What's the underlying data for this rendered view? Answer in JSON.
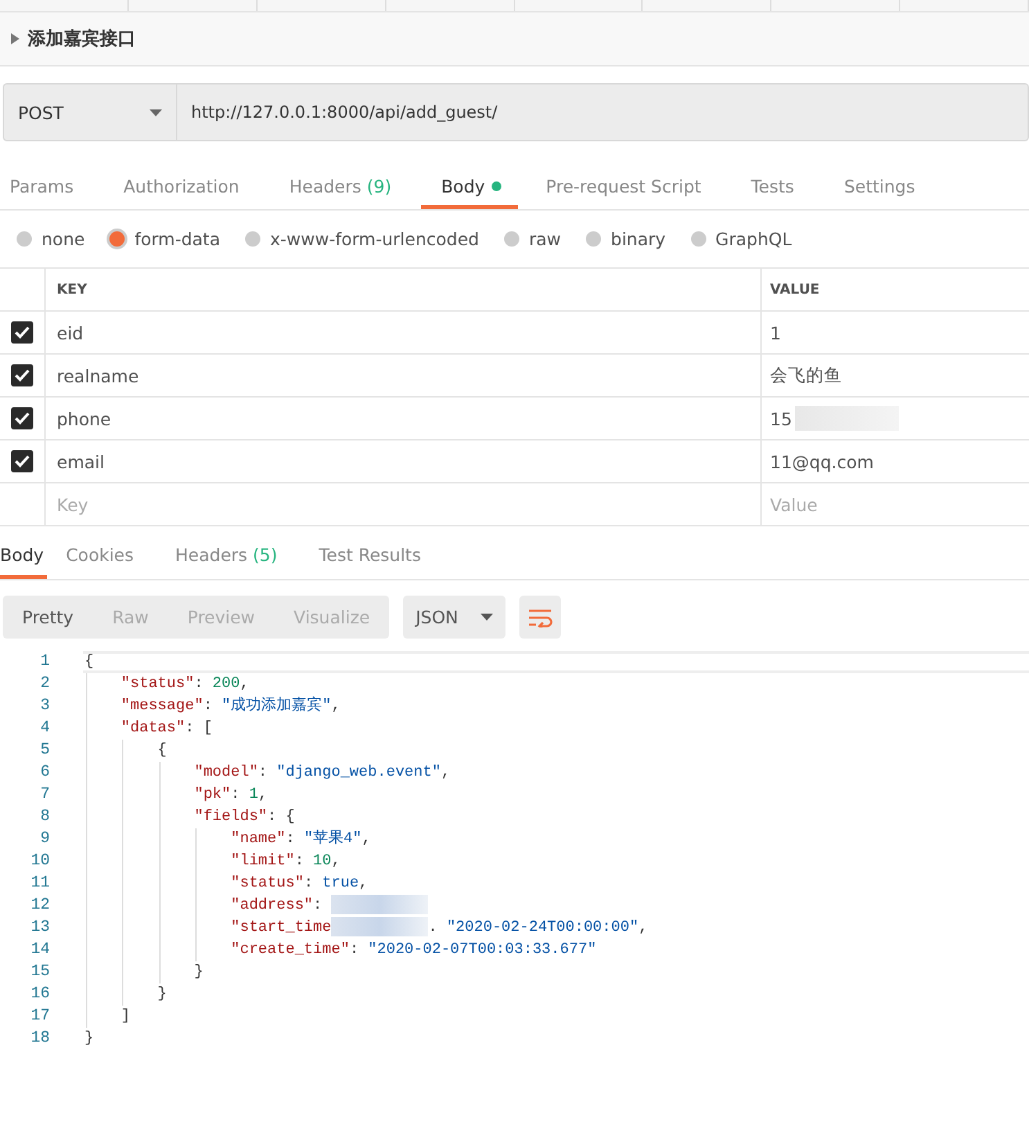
{
  "request": {
    "title": "添加嘉宾接口",
    "method": "POST",
    "url": "http://127.0.0.1:8000/api/add_guest/"
  },
  "request_tabs": [
    {
      "label": "Params",
      "selected": false
    },
    {
      "label": "Authorization",
      "selected": false
    },
    {
      "label": "Headers",
      "count": "(9)",
      "selected": false
    },
    {
      "label": "Body",
      "dot": true,
      "selected": true
    },
    {
      "label": "Pre-request Script",
      "selected": false
    },
    {
      "label": "Tests",
      "selected": false
    },
    {
      "label": "Settings",
      "selected": false
    }
  ],
  "body_types": [
    {
      "label": "none",
      "selected": false
    },
    {
      "label": "form-data",
      "selected": true
    },
    {
      "label": "x-www-form-urlencoded",
      "selected": false
    },
    {
      "label": "raw",
      "selected": false
    },
    {
      "label": "binary",
      "selected": false
    },
    {
      "label": "GraphQL",
      "selected": false
    }
  ],
  "params": {
    "columns": [
      "KEY",
      "VALUE"
    ],
    "rows": [
      {
        "key": "eid",
        "value": "1",
        "checked": true
      },
      {
        "key": "realname",
        "value": "会飞的鱼",
        "checked": true
      },
      {
        "key": "phone",
        "value": "15",
        "checked": true,
        "redacted": true
      },
      {
        "key": "email",
        "value": "11@qq.com",
        "checked": true
      }
    ],
    "new_row": {
      "key": {
        "placeholder": "Key"
      },
      "value": {
        "placeholder": "Value"
      }
    }
  },
  "response_tabs": [
    {
      "label": "Body",
      "selected": true
    },
    {
      "label": "Cookies",
      "selected": false
    },
    {
      "label": "Headers",
      "count": "(5)",
      "selected": false
    },
    {
      "label": "Test Results",
      "selected": false
    }
  ],
  "view_modes": [
    {
      "label": "Pretty",
      "selected": true
    },
    {
      "label": "Raw",
      "selected": false
    },
    {
      "label": "Preview",
      "selected": false
    },
    {
      "label": "Visualize",
      "selected": false
    }
  ],
  "format": "JSON",
  "code_lines": [
    {
      "number": "1",
      "tokens": [
        {
          "kind": "punct",
          "text": "{"
        }
      ]
    },
    {
      "number": "2",
      "tokens": [
        {
          "kind": "key",
          "text": "    \"status\""
        },
        {
          "kind": "punct",
          "text": ": "
        },
        {
          "kind": "num",
          "text": "200"
        },
        {
          "kind": "punct",
          "text": ","
        }
      ]
    },
    {
      "number": "3",
      "tokens": [
        {
          "kind": "key",
          "text": "    \"message\""
        },
        {
          "kind": "punct",
          "text": ": "
        },
        {
          "kind": "str",
          "text": "\"成功添加嘉宾\""
        },
        {
          "kind": "punct",
          "text": ","
        }
      ]
    },
    {
      "number": "4",
      "tokens": [
        {
          "kind": "key",
          "text": "    \"datas\""
        },
        {
          "kind": "punct",
          "text": ": ["
        }
      ]
    },
    {
      "number": "5",
      "tokens": [
        {
          "kind": "punct",
          "text": "        {"
        }
      ]
    },
    {
      "number": "6",
      "tokens": [
        {
          "kind": "key",
          "text": "            \"model\""
        },
        {
          "kind": "punct",
          "text": ": "
        },
        {
          "kind": "str",
          "text": "\"django_web.event\""
        },
        {
          "kind": "punct",
          "text": ","
        }
      ]
    },
    {
      "number": "7",
      "tokens": [
        {
          "kind": "key",
          "text": "            \"pk\""
        },
        {
          "kind": "punct",
          "text": ": "
        },
        {
          "kind": "num",
          "text": "1"
        },
        {
          "kind": "punct",
          "text": ","
        }
      ]
    },
    {
      "number": "8",
      "tokens": [
        {
          "kind": "key",
          "text": "            \"fields\""
        },
        {
          "kind": "punct",
          "text": ": {"
        }
      ]
    },
    {
      "number": "9",
      "tokens": [
        {
          "kind": "key",
          "text": "                \"name\""
        },
        {
          "kind": "punct",
          "text": ": "
        },
        {
          "kind": "str",
          "text": "\"苹果4\""
        },
        {
          "kind": "punct",
          "text": ","
        }
      ]
    },
    {
      "number": "10",
      "tokens": [
        {
          "kind": "key",
          "text": "                \"limit\""
        },
        {
          "kind": "punct",
          "text": ": "
        },
        {
          "kind": "num",
          "text": "10"
        },
        {
          "kind": "punct",
          "text": ","
        }
      ]
    },
    {
      "number": "11",
      "tokens": [
        {
          "kind": "key",
          "text": "                \"status\""
        },
        {
          "kind": "punct",
          "text": ": "
        },
        {
          "kind": "bool",
          "text": "true"
        },
        {
          "kind": "punct",
          "text": ","
        }
      ]
    },
    {
      "number": "12",
      "tokens": [
        {
          "kind": "key",
          "text": "                \"address\""
        },
        {
          "kind": "punct",
          "text": ": "
        },
        {
          "kind": "redacted"
        }
      ]
    },
    {
      "number": "13",
      "tokens": [
        {
          "kind": "key",
          "text": "                \"start_time"
        },
        {
          "kind": "redacted"
        },
        {
          "kind": "punct",
          "text": ". "
        },
        {
          "kind": "str",
          "text": "\"2020-02-24T00:00:00\""
        },
        {
          "kind": "punct",
          "text": ","
        }
      ]
    },
    {
      "number": "14",
      "tokens": [
        {
          "kind": "key",
          "text": "                \"create_time\""
        },
        {
          "kind": "punct",
          "text": ": "
        },
        {
          "kind": "str",
          "text": "\"2020-02-07T00:03:33.677\""
        }
      ]
    },
    {
      "number": "15",
      "tokens": [
        {
          "kind": "punct",
          "text": "            }"
        }
      ]
    },
    {
      "number": "16",
      "tokens": [
        {
          "kind": "punct",
          "text": "        }"
        }
      ]
    },
    {
      "number": "17",
      "tokens": [
        {
          "kind": "punct",
          "text": "    ]"
        }
      ]
    },
    {
      "number": "18",
      "tokens": [
        {
          "kind": "punct",
          "text": "}"
        }
      ]
    }
  ]
}
